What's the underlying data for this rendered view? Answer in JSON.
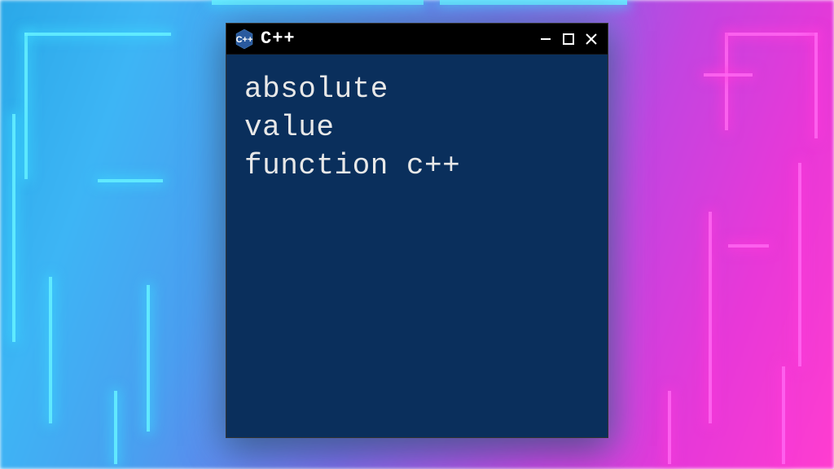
{
  "window": {
    "title": "C++",
    "icon_name": "cpp-hex-icon"
  },
  "terminal": {
    "content_line1": "absolute",
    "content_line2": "value",
    "content_line3": "function c++"
  },
  "colors": {
    "terminal_bg": "#0a2f5c",
    "titlebar_bg": "#000000",
    "text": "#e8e8e8"
  }
}
